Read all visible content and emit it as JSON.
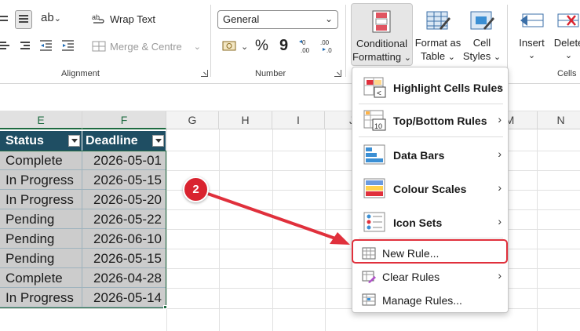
{
  "ribbon": {
    "alignment": {
      "wrap_text": "Wrap Text",
      "merge_centre": "Merge & Centre",
      "group_label": "Alignment"
    },
    "number": {
      "format_value": "General",
      "group_label": "Number",
      "percent": "%",
      "comma": "9"
    },
    "styles": {
      "conditional_formatting_line1": "Conditional",
      "conditional_formatting_line2": "Formatting",
      "format_as_table_line1": "Format as",
      "format_as_table_line2": "Table",
      "cell_styles_line1": "Cell",
      "cell_styles_line2": "Styles"
    },
    "cells": {
      "insert": "Insert",
      "delete": "Delete",
      "group_label": "Cells"
    }
  },
  "grid": {
    "columns": [
      "E",
      "F",
      "G",
      "H",
      "I",
      "J",
      "M",
      "N"
    ],
    "table_headers": {
      "status": "Status",
      "deadline": "Deadline"
    },
    "rows": [
      {
        "status": "Complete",
        "deadline": "2026-05-01"
      },
      {
        "status": "In Progress",
        "deadline": "2026-05-15"
      },
      {
        "status": "In Progress",
        "deadline": "2026-05-20"
      },
      {
        "status": "Pending",
        "deadline": "2026-05-22"
      },
      {
        "status": "Pending",
        "deadline": "2026-06-10"
      },
      {
        "status": "Pending",
        "deadline": "2026-05-15"
      },
      {
        "status": "Complete",
        "deadline": "2026-04-28"
      },
      {
        "status": "In Progress",
        "deadline": "2026-05-14"
      }
    ]
  },
  "menu": {
    "items": [
      {
        "label": "Highlight Cells Rules",
        "icon": "highlight-cells-icon"
      },
      {
        "label": "Top/Bottom Rules",
        "icon": "top-bottom-icon"
      },
      {
        "label": "Data Bars",
        "icon": "data-bars-icon"
      },
      {
        "label": "Colour Scales",
        "icon": "colour-scales-icon"
      },
      {
        "label": "Icon Sets",
        "icon": "icon-sets-icon"
      },
      {
        "label": "New Rule...",
        "icon": "new-rule-icon"
      },
      {
        "label": "Clear Rules",
        "icon": "clear-rules-icon"
      },
      {
        "label": "Manage Rules...",
        "icon": "manage-rules-icon"
      }
    ]
  },
  "annotation": {
    "step": "2"
  },
  "colors": {
    "table_header": "#1f4e63",
    "highlight": "#e0303c",
    "accent_green": "#1e6b41"
  }
}
